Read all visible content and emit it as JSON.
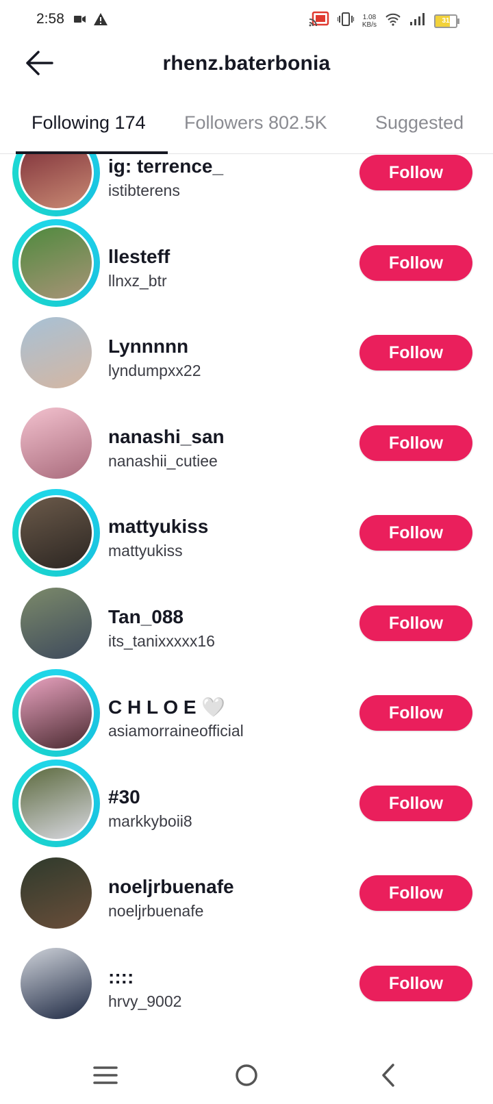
{
  "status_bar": {
    "time": "2:58",
    "left_icons": [
      "video-camera-icon",
      "warning-icon"
    ],
    "net_speed_value": "1.08",
    "net_speed_unit": "KB/s",
    "battery_level": "31"
  },
  "header": {
    "title": "rhenz.baterbonia",
    "back_icon": "arrow-left-icon"
  },
  "tabs": [
    {
      "label": "Following 174",
      "active": true
    },
    {
      "label": "Followers 802.5K",
      "active": false
    },
    {
      "label": "Suggested",
      "active": false
    }
  ],
  "follow_label": "Follow",
  "users": [
    {
      "name": "ig: terrence_",
      "handle": "istibterens",
      "story_ring": true,
      "avatar_colors": [
        "#7a2b36",
        "#c98a74"
      ]
    },
    {
      "name": "llesteff",
      "handle": "llnxz_btr",
      "story_ring": true,
      "avatar_colors": [
        "#4f8a3e",
        "#a89377"
      ]
    },
    {
      "name": "Lynnnnn",
      "handle": "lyndumpxx22",
      "story_ring": false,
      "avatar_colors": [
        "#a7c1d6",
        "#d4b6a2"
      ]
    },
    {
      "name": "nanashi_san",
      "handle": "nanashii_cutiee",
      "story_ring": false,
      "avatar_colors": [
        "#f3c2cf",
        "#a96b7c"
      ]
    },
    {
      "name": "mattyukiss",
      "handle": "mattyukiss",
      "story_ring": true,
      "avatar_colors": [
        "#6b5a4a",
        "#2c2622"
      ]
    },
    {
      "name": "Tan_088",
      "handle": "its_tanixxxxx16",
      "story_ring": false,
      "avatar_colors": [
        "#7c8a6a",
        "#3e4a5c"
      ]
    },
    {
      "name": "C H L O E 🤍",
      "handle": "asiamorraineofficial",
      "story_ring": true,
      "avatar_colors": [
        "#e9a3c0",
        "#4a2a30"
      ]
    },
    {
      "name": "#30",
      "handle": "markkyboii8",
      "story_ring": true,
      "avatar_colors": [
        "#5c6a3e",
        "#d8d8e0"
      ]
    },
    {
      "name": "noeljrbuenafe",
      "handle": "noeljrbuenafe",
      "story_ring": false,
      "avatar_colors": [
        "#2e3a2c",
        "#6a4e3a"
      ]
    },
    {
      "name": "::::",
      "handle": "hrvy_9002",
      "story_ring": false,
      "avatar_colors": [
        "#cfd3da",
        "#1f2a44"
      ]
    }
  ],
  "nav_bar": {
    "buttons": [
      "menu-icon",
      "home-circle-icon",
      "back-chevron-icon"
    ]
  }
}
